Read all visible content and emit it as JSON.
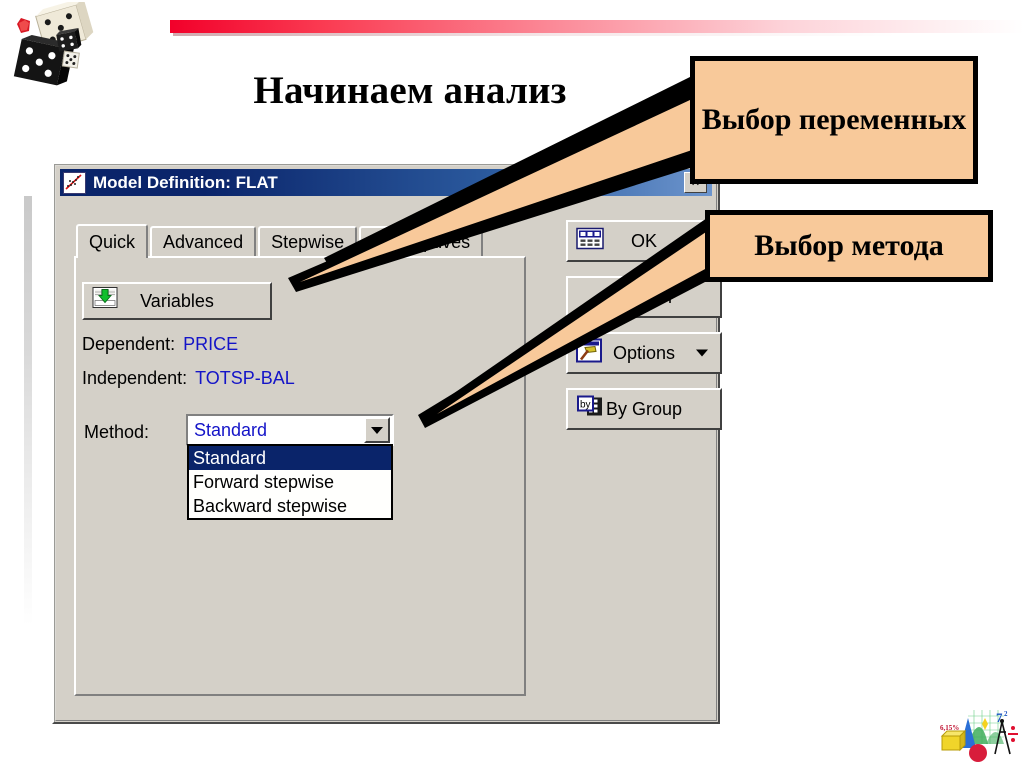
{
  "slide": {
    "title": "Начинаем анализ",
    "accent_color": "#f2002a",
    "callout_fill": "#f8c99a"
  },
  "decor": {
    "dice_icon": "dice-clipart",
    "math_logo_icon": "statistics-clipart-logo",
    "red_bar_icon": "red-gradient-rule",
    "left_rule_icon": "vertical-gray-rule"
  },
  "dialog": {
    "title": "Model Definition: FLAT",
    "title_icon": "scatterplot-regression-icon",
    "close_label": "✕",
    "tabs": [
      {
        "label": "Quick",
        "active": true
      },
      {
        "label": "Advanced",
        "active": false
      },
      {
        "label": "Stepwise",
        "active": false
      },
      {
        "label": "Descriptives",
        "active": false
      }
    ],
    "variables_button": {
      "label": "Variables",
      "icon": "spreadsheet-down-arrow-icon"
    },
    "fields": [
      {
        "label": "Dependent:",
        "value": "PRICE",
        "value_color": "#1414c8"
      },
      {
        "label": "Independent:",
        "value": "TOTSP-BAL",
        "value_color": "#1414c8"
      }
    ],
    "method": {
      "label": "Method:",
      "value": "Standard",
      "value_color": "#1414c8",
      "dropdown_icon": "chevron-down-icon",
      "options": [
        {
          "label": "Standard",
          "selected": true
        },
        {
          "label": "Forward stepwise",
          "selected": false
        },
        {
          "label": "Backward stepwise",
          "selected": false
        }
      ]
    },
    "action_buttons": [
      {
        "label": "OK",
        "icon": "table-ok-icon",
        "has_menu": false
      },
      {
        "label": "Cancel",
        "icon": "",
        "has_menu": false
      },
      {
        "label": "Options",
        "icon": "hammer-options-icon",
        "has_menu": true
      },
      {
        "label": "By Group",
        "icon": "by-group-icon",
        "has_menu": false
      }
    ]
  },
  "callouts": [
    {
      "id": "variables",
      "text": "Выбор переменных"
    },
    {
      "id": "method",
      "text": "Выбор метода"
    }
  ]
}
